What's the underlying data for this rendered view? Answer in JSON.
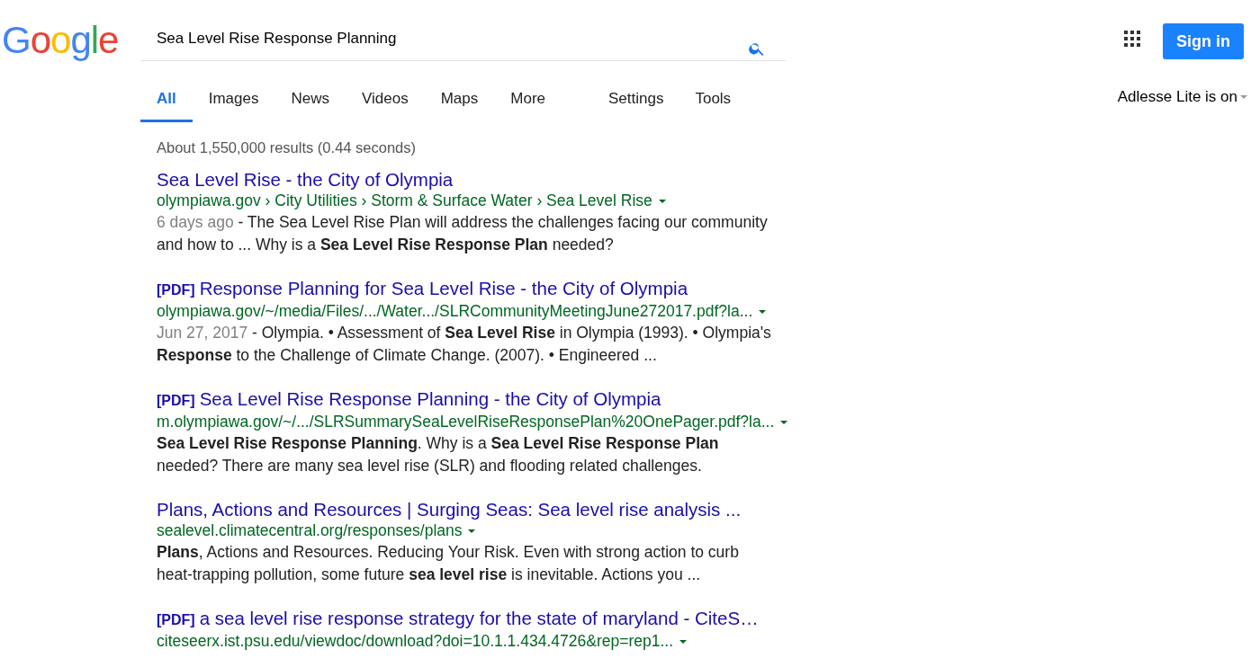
{
  "logo": "Google",
  "search": {
    "value": "Sea Level Rise Response Planning"
  },
  "header": {
    "sign_in": "Sign in"
  },
  "tabs": [
    {
      "label": "All",
      "selected": true
    },
    {
      "label": "Images",
      "selected": false
    },
    {
      "label": "News",
      "selected": false
    },
    {
      "label": "Videos",
      "selected": false
    },
    {
      "label": "Maps",
      "selected": false
    },
    {
      "label": "More",
      "selected": false
    }
  ],
  "tools": [
    "Settings",
    "Tools"
  ],
  "adlesse": "Adlesse Lite is on",
  "stats": "About 1,550,000 results (0.44 seconds)",
  "results": [
    {
      "title": "Sea Level Rise - the City of Olympia",
      "url": "olympiawa.gov › City Utilities › Storm & Surface Water › Sea Level Rise",
      "date": "6 days ago",
      "snippet": "- The Sea Level Rise Plan will address the challenges facing our community and how to ... Why is a **Sea Level Rise Response Plan** needed?"
    },
    {
      "format": "[PDF]",
      "title": "Response Planning for Sea Level Rise - the City of Olympia",
      "url": "olympiawa.gov/~/media/Files/.../Water.../SLRCommunityMeetingJune272017.pdf?la...",
      "date": "Jun 27, 2017",
      "snippet": "- Olympia. • Assessment of **Sea Level Rise** in Olympia (1993). • Olympia's **Response** to the Challenge of Climate Change. (2007). • Engineered ..."
    },
    {
      "format": "[PDF]",
      "title": "Sea Level Rise Response Planning - the City of Olympia",
      "url": "m.olympiawa.gov/~/.../SLRSummarySeaLevelRiseResponsePlan%20OnePager.pdf?la...",
      "snippet": "**Sea Level Rise Response Planning**. Why is a **Sea Level Rise Response Plan** needed? There are many sea level rise (SLR) and flooding related challenges."
    },
    {
      "title": "Plans, Actions and Resources | Surging Seas: Sea level rise analysis ...",
      "url": "sealevel.climatecentral.org/responses/plans",
      "snippet": "**Plans**, Actions and Resources. Reducing Your Risk. Even with strong action to curb heat-trapping pollution, some future **sea level rise** is inevitable. Actions you  ..."
    },
    {
      "format": "[PDF]",
      "title": "a sea level rise response strategy for the state of maryland - CiteS…",
      "url": "citeseerx.ist.psu.edu/viewdoc/download?doi=10.1.1.434.4726&rep=rep1..."
    }
  ]
}
